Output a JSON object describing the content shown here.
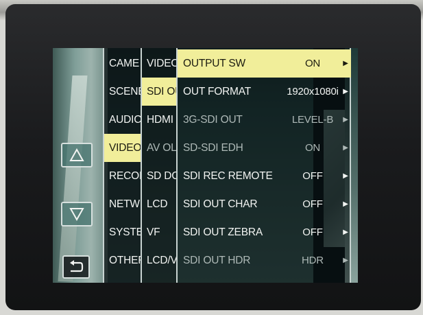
{
  "menu": {
    "col1": [
      {
        "label": "CAME"
      },
      {
        "label": "SCENE"
      },
      {
        "label": "AUDIC"
      },
      {
        "label": "VIDEO",
        "selected": true
      },
      {
        "label": "RECOF"
      },
      {
        "label": "NETW"
      },
      {
        "label": "SYSTE"
      },
      {
        "label": "OTHEF"
      }
    ],
    "col2": [
      {
        "label": "VIDEO"
      },
      {
        "label": "SDI OU",
        "selected": true
      },
      {
        "label": "HDMI"
      },
      {
        "label": "AV OL",
        "dim": true
      },
      {
        "label": "SD DC"
      },
      {
        "label": "LCD"
      },
      {
        "label": "VF"
      },
      {
        "label": "LCD/V"
      }
    ],
    "col3": [
      {
        "label": "OUTPUT SW",
        "value": "ON",
        "selected": true
      },
      {
        "label": "OUT FORMAT",
        "value": "1920x1080i"
      },
      {
        "label": "3G-SDI OUT",
        "value": "LEVEL-B",
        "dim": true
      },
      {
        "label": "SD-SDI EDH",
        "value": "ON",
        "dim": true
      },
      {
        "label": "SDI REC REMOTE",
        "value": "OFF"
      },
      {
        "label": "SDI OUT CHAR",
        "value": "OFF"
      },
      {
        "label": "SDI OUT ZEBRA",
        "value": "OFF"
      },
      {
        "label": "SDI OUT HDR",
        "value": "HDR",
        "dim": true
      }
    ],
    "arrow_glyph": "▶"
  },
  "icons": {
    "up": "up-triangle-icon",
    "down": "down-triangle-icon",
    "back": "return-arrow-icon"
  },
  "colors": {
    "selection": "#f1ee9a",
    "button_fill": "#46736e",
    "accent_blue": "#2aa9e6"
  }
}
